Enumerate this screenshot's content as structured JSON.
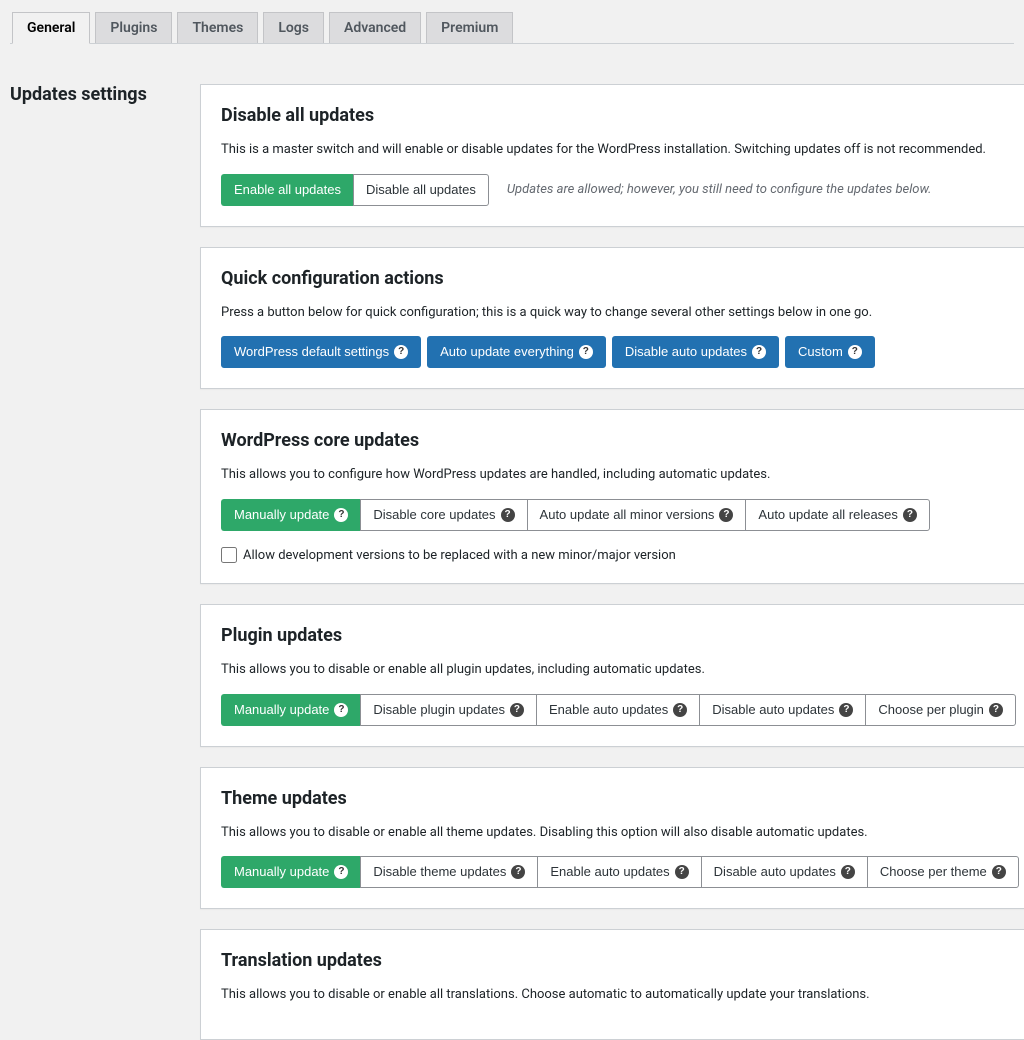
{
  "tabs": [
    "General",
    "Plugins",
    "Themes",
    "Logs",
    "Advanced",
    "Premium"
  ],
  "active_tab": 0,
  "sidebar_title": "Updates settings",
  "sections": {
    "disable_all": {
      "title": "Disable all updates",
      "desc": "This is a master switch and will enable or disable updates for the WordPress installation. Switching updates off is not recommended.",
      "options": [
        "Enable all updates",
        "Disable all updates"
      ],
      "hint": "Updates are allowed; however, you still need to configure the updates below."
    },
    "quick_config": {
      "title": "Quick configuration actions",
      "desc": "Press a button below for quick configuration; this is a quick way to change several other settings below in one go.",
      "buttons": [
        "WordPress default settings",
        "Auto update everything",
        "Disable auto updates",
        "Custom"
      ]
    },
    "core": {
      "title": "WordPress core updates",
      "desc": "This allows you to configure how WordPress updates are handled, including automatic updates.",
      "options": [
        "Manually update",
        "Disable core updates",
        "Auto update all minor versions",
        "Auto update all releases"
      ],
      "checkbox_label": "Allow development versions to be replaced with a new minor/major version"
    },
    "plugin": {
      "title": "Plugin updates",
      "desc": "This allows you to disable or enable all plugin updates, including automatic updates.",
      "options": [
        "Manually update",
        "Disable plugin updates",
        "Enable auto updates",
        "Disable auto updates",
        "Choose per plugin"
      ]
    },
    "theme": {
      "title": "Theme updates",
      "desc": "This allows you to disable or enable all theme updates. Disabling this option will also disable automatic updates.",
      "options": [
        "Manually update",
        "Disable theme updates",
        "Enable auto updates",
        "Disable auto updates",
        "Choose per theme"
      ]
    },
    "translation": {
      "title": "Translation updates",
      "desc": "This allows you to disable or enable all translations. Choose automatic to automatically update your translations."
    }
  }
}
